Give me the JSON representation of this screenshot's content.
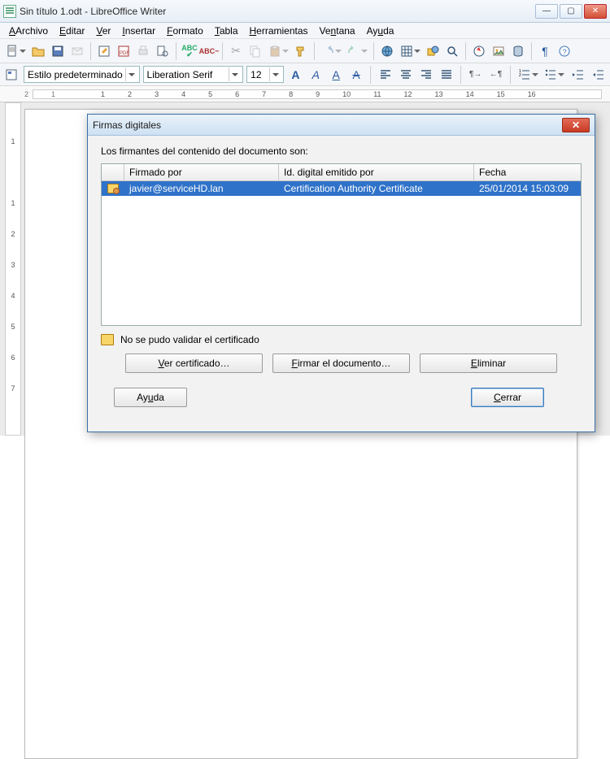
{
  "window": {
    "title": "Sin título 1.odt - LibreOffice Writer"
  },
  "menu": {
    "archivo": "Archivo",
    "editar": "Editar",
    "ver": "Ver",
    "insertar": "Insertar",
    "formato": "Formato",
    "tabla": "Tabla",
    "herramientas": "Herramientas",
    "ventana": "Ventana",
    "ayuda": "Ayuda"
  },
  "fmt": {
    "style": "Estilo predeterminado",
    "font": "Liberation Serif",
    "size": "12"
  },
  "ruler_ticks": [
    "2",
    "1",
    "",
    "1",
    "2",
    "3",
    "4",
    "5",
    "6",
    "7",
    "8",
    "9",
    "10",
    "11",
    "12",
    "13",
    "14",
    "15",
    "16"
  ],
  "vruler_ticks": [
    "",
    "1",
    "",
    "1",
    "2",
    "3",
    "4",
    "5",
    "6",
    "7"
  ],
  "dialog": {
    "title": "Firmas digitales",
    "message": "Los firmantes del contenido del documento son:",
    "col_signed": "Firmado por",
    "col_issued": "Id. digital emitido por",
    "col_date": "Fecha",
    "row": {
      "signed_by": "javier@serviceHD.lan",
      "issued_by": "Certification Authority Certificate",
      "date": "25/01/2014 15:03:09"
    },
    "status": "No se pudo validar el certificado",
    "btn_view": "Ver certificado…",
    "btn_sign": "Firmar el documento…",
    "btn_delete": "Eliminar",
    "btn_help": "Ayuda",
    "btn_close": "Cerrar"
  }
}
